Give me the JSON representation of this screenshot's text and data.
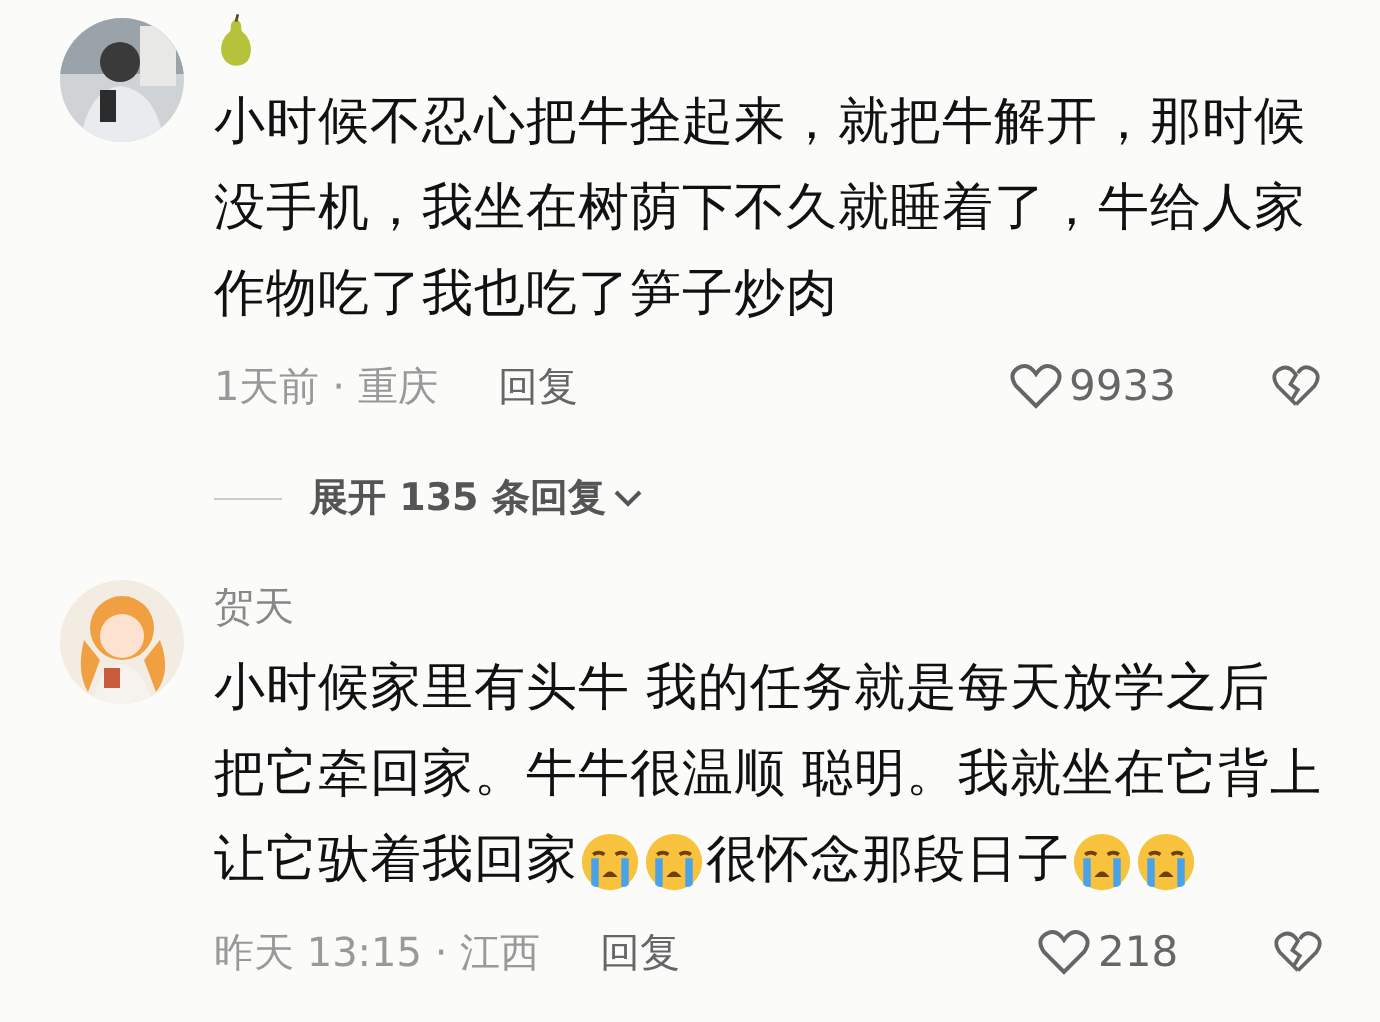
{
  "comments": [
    {
      "author": {
        "kind": "icon"
      },
      "lines": [
        [
          {
            "kind": "text",
            "text": "小时候不忍心把牛拴起来，就把牛解开，那时候"
          }
        ],
        [
          {
            "kind": "text",
            "text": "没手机，我坐在树荫下不久就睡着了，牛给人家"
          }
        ],
        [
          {
            "kind": "text",
            "text": "作物吃了我也吃了笋子炒肉"
          }
        ]
      ],
      "meta": "1天前 · 重庆",
      "reply": "回复",
      "likes": "9933",
      "expand": "展开 135 条回复"
    },
    {
      "author": {
        "kind": "text",
        "text": "贺天"
      },
      "lines": [
        [
          {
            "kind": "text",
            "text": "小时候家里有头牛  我的任务就是每天放学之后"
          }
        ],
        [
          {
            "kind": "text",
            "text": "把它牵回家。牛牛很温顺 聪明。我就坐在它背上"
          }
        ],
        [
          {
            "kind": "text",
            "text": "让它驮着我回家"
          },
          {
            "kind": "emoji"
          },
          {
            "kind": "emoji"
          },
          {
            "kind": "text",
            "text": "很怀念那段日子"
          },
          {
            "kind": "emoji"
          },
          {
            "kind": "emoji"
          }
        ]
      ],
      "meta": "昨天 13:15 · 江西",
      "reply": "回复",
      "likes": "218"
    }
  ]
}
